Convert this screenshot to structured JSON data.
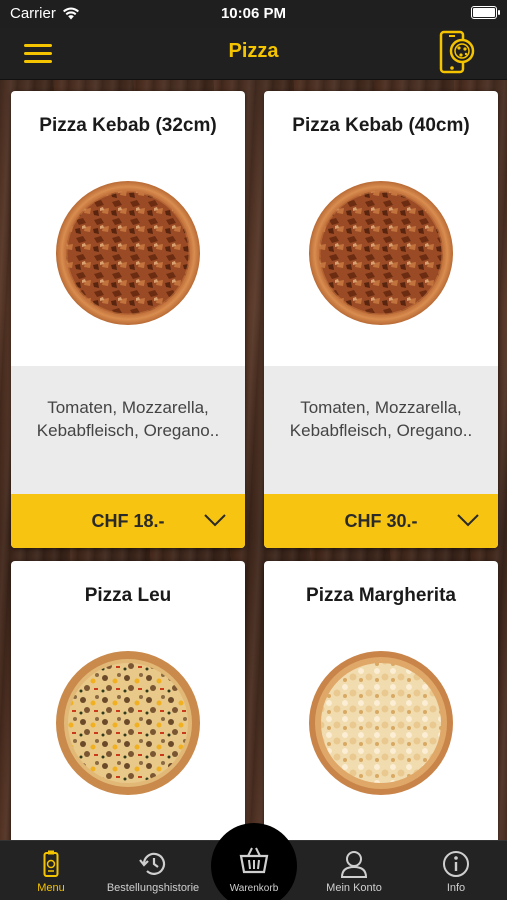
{
  "status_bar": {
    "carrier": "Carrier",
    "time": "10:06 PM"
  },
  "nav": {
    "title": "Pizza"
  },
  "colors": {
    "accent": "#f5c400",
    "price_bar": "#f6c411",
    "nav_bg": "#202020"
  },
  "products": [
    {
      "name": "Pizza Kebab (32cm)",
      "description": "Tomaten, Mozzarella, Kebabfleisch, Oregano..",
      "price": "CHF 18.-",
      "image": "pizza-kebab"
    },
    {
      "name": "Pizza Kebab (40cm)",
      "description": "Tomaten, Mozzarella, Kebabfleisch, Oregano..",
      "price": "CHF 30.-",
      "image": "pizza-kebab"
    },
    {
      "name": "Pizza Leu",
      "image": "pizza-leu"
    },
    {
      "name": "Pizza Margherita",
      "image": "pizza-margherita"
    }
  ],
  "tabs": [
    {
      "label": "Menu",
      "icon": "phone-menu-icon",
      "active": true
    },
    {
      "label": "Bestellungshistorie",
      "icon": "history-icon",
      "active": false
    },
    {
      "label": "Warenkorb",
      "icon": "cart-icon",
      "active": false
    },
    {
      "label": "Mein Konto",
      "icon": "user-icon",
      "active": false
    },
    {
      "label": "Info",
      "icon": "info-icon",
      "active": false
    }
  ]
}
